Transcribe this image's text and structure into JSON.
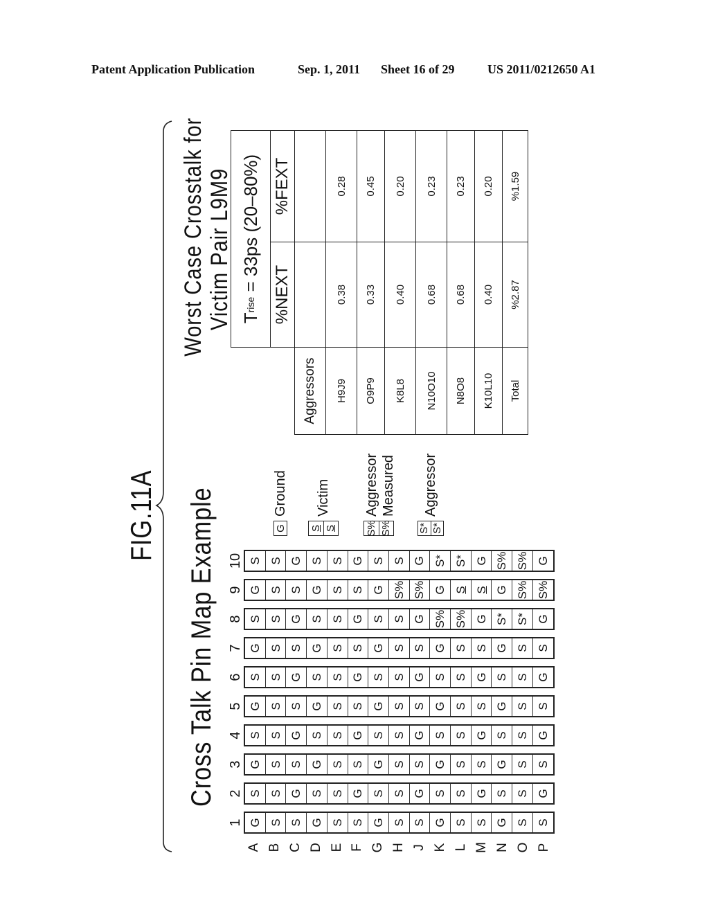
{
  "header": {
    "publication": "Patent Application Publication",
    "date": "Sep. 1, 2011",
    "sheet": "Sheet 16 of 29",
    "number": "US 2011/0212650 A1"
  },
  "figure": {
    "label": "FIG.11A",
    "pin_map": {
      "title": "Cross Talk Pin Map Example",
      "column_letters": [
        "A",
        "B",
        "C",
        "D",
        "E",
        "F",
        "G",
        "H",
        "J",
        "K",
        "L",
        "M",
        "N",
        "O",
        "P"
      ],
      "rows": [
        {
          "number": "1",
          "cells": [
            "G",
            "S",
            "S",
            "G",
            "S",
            "S",
            "G",
            "S",
            "S",
            "G",
            "S",
            "S",
            "G",
            "S",
            "S"
          ]
        },
        {
          "number": "2",
          "cells": [
            "S",
            "S",
            "G",
            "S",
            "S",
            "G",
            "S",
            "S",
            "G",
            "S",
            "S",
            "G",
            "S",
            "S",
            "G"
          ]
        },
        {
          "number": "3",
          "cells": [
            "G",
            "S",
            "S",
            "G",
            "S",
            "S",
            "G",
            "S",
            "S",
            "G",
            "S",
            "S",
            "G",
            "S",
            "S"
          ]
        },
        {
          "number": "4",
          "cells": [
            "S",
            "S",
            "G",
            "S",
            "S",
            "G",
            "S",
            "S",
            "G",
            "S",
            "S",
            "G",
            "S",
            "S",
            "G"
          ]
        },
        {
          "number": "5",
          "cells": [
            "G",
            "S",
            "S",
            "G",
            "S",
            "S",
            "G",
            "S",
            "S",
            "G",
            "S",
            "S",
            "G",
            "S",
            "S"
          ]
        },
        {
          "number": "6",
          "cells": [
            "S",
            "S",
            "G",
            "S",
            "S",
            "G",
            "S",
            "S",
            "G",
            "S",
            "S",
            "G",
            "S",
            "S",
            "G"
          ]
        },
        {
          "number": "7",
          "cells": [
            "G",
            "S",
            "S",
            "G",
            "S",
            "S",
            "G",
            "S",
            "S",
            "G",
            "S",
            "S",
            "G",
            "S",
            "S"
          ]
        },
        {
          "number": "8",
          "cells": [
            "S",
            "S",
            "G",
            "S",
            "S",
            "G",
            "S",
            "S",
            "G",
            "S%",
            "S%",
            "G",
            "S*",
            "S*",
            "G"
          ]
        },
        {
          "number": "9",
          "cells": [
            "G",
            "S",
            "S",
            "G",
            "S",
            "S",
            "G",
            "S%",
            "S%",
            "G",
            "S_",
            "S_",
            "G",
            "S%",
            "S%"
          ]
        },
        {
          "number": "10",
          "cells": [
            "S",
            "S",
            "G",
            "S",
            "S",
            "G",
            "S",
            "S",
            "G",
            "S*",
            "S*",
            "G",
            "S%",
            "S%",
            "G"
          ]
        }
      ],
      "legend": [
        {
          "symbols": [
            "G"
          ],
          "label": "Ground"
        },
        {
          "symbols": [
            "S_",
            "S_"
          ],
          "label": "Victim"
        },
        {
          "symbols": [
            "S%",
            "S%"
          ],
          "label": "Aggressor Measured",
          "label_lines": [
            "Aggressor",
            "Measured"
          ]
        },
        {
          "symbols": [
            "S*",
            "S*"
          ],
          "label": "Aggressor"
        }
      ]
    },
    "crosstalk_table": {
      "title_line1": "Worst Case Crosstalk for",
      "title_line2": "Victim Pair L9M9",
      "trise_prefix": "T",
      "trise_sub": "rise",
      "trise_text": " = 33ps (20–80%)",
      "col_next": "%NEXT",
      "col_fext": "%FEXT",
      "row_header": "Aggressors",
      "rows": [
        {
          "aggressor": "H9J9",
          "next": "0.38",
          "fext": "0.28"
        },
        {
          "aggressor": "O9P9",
          "next": "0.33",
          "fext": "0.45"
        },
        {
          "aggressor": "K8L8",
          "next": "0.40",
          "fext": "0.20"
        },
        {
          "aggressor": "N10O10",
          "next": "0.68",
          "fext": "0.23"
        },
        {
          "aggressor": "N8O8",
          "next": "0.68",
          "fext": "0.23"
        },
        {
          "aggressor": "K10L10",
          "next": "0.40",
          "fext": "0.20"
        },
        {
          "aggressor": "Total",
          "next": "%2.87",
          "fext": "%1.59"
        }
      ]
    }
  }
}
